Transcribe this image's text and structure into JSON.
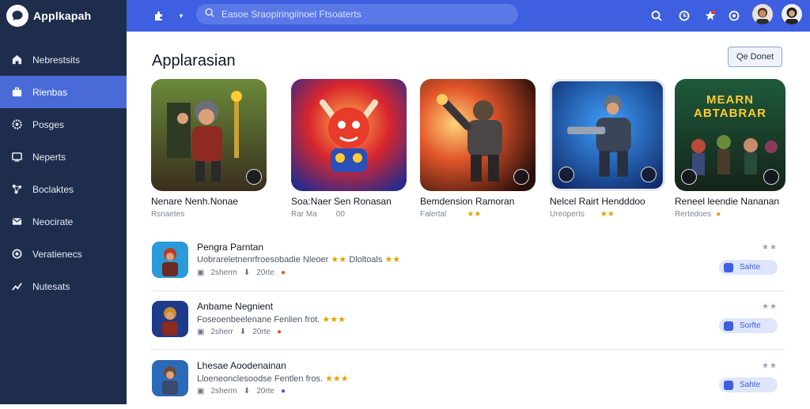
{
  "app": {
    "title": "Applkapah"
  },
  "sidebar": {
    "items": [
      {
        "label": "Nebrestsits",
        "icon": "home-icon"
      },
      {
        "label": "Rienbas",
        "icon": "briefcase-icon",
        "active": true
      },
      {
        "label": "Posges",
        "icon": "gear-icon"
      },
      {
        "label": "Neperts",
        "icon": "monitor-icon"
      },
      {
        "label": "Boclaktes",
        "icon": "network-icon"
      },
      {
        "label": "Neocirate",
        "icon": "mail-icon"
      },
      {
        "label": "Veratienecs",
        "icon": "settings-icon"
      },
      {
        "label": "Nutesats",
        "icon": "chart-icon"
      }
    ]
  },
  "topbar": {
    "search_placeholder": "Easoe Sraopiringilnoel Ftsoaterts"
  },
  "main": {
    "title": "Applarasian",
    "top_button": "Qe Donet",
    "featured": [
      {
        "title": "Nenare Nenh.Nonae",
        "meta1": "Rsnaetes",
        "meta2": ""
      },
      {
        "title": "Soa:Naer Sen Ronasan",
        "meta1": "Rar Ma",
        "meta2": "00"
      },
      {
        "title": "Bemdension Ramoran",
        "meta1": "Falertal",
        "meta2": ""
      },
      {
        "title": "Nelcel Rairt Hendddoo",
        "meta1": "Ureoperts",
        "meta2": ""
      },
      {
        "title": "Reneel leendie Nananan",
        "meta1": "Rertedoes",
        "meta2": ""
      }
    ],
    "featured_badge_text": "MEARN ABTABRAR",
    "list": [
      {
        "title": "Pengra Parntan",
        "desc": "Uobrareletnenrfroesobadie Nleoer",
        "tag": "Dloltoals",
        "size": "2sherm",
        "size2": "20rte",
        "button": "Sahte"
      },
      {
        "title": "Anbame Negnient",
        "desc": "Foseoenbeelenane Fenlien frot.",
        "tag": "",
        "size": "2sherr",
        "size2": "20rte",
        "button": "Sorfte"
      },
      {
        "title": "Lhesae Aoodenainan",
        "desc": "Lloeneonclesoodse Fentlen fros.",
        "tag": "",
        "size": "2sherm",
        "size2": "20rte",
        "button": "Sahte"
      }
    ]
  },
  "colors": {
    "sidebar": "#1f2d4d",
    "accent": "#3d5fe0",
    "active": "#4a6ad8"
  }
}
